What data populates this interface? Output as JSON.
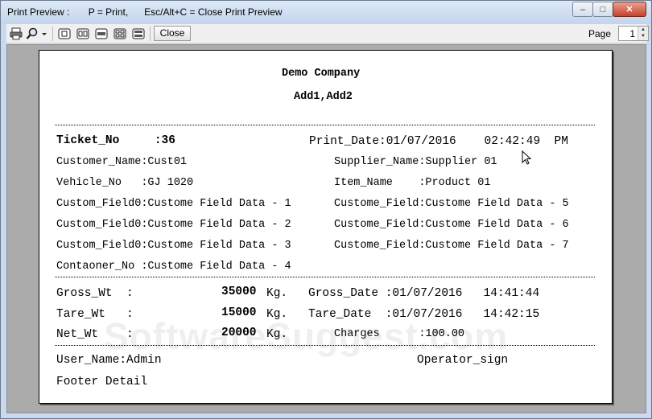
{
  "window": {
    "title": "Print Preview :       P = Print,      Esc/Alt+C = Close Print Preview",
    "controls": {
      "minimize": "–",
      "maximize": "□",
      "close": "✕"
    }
  },
  "toolbar": {
    "close_label": "Close",
    "page_label": "Page",
    "page_value": "1",
    "icons": [
      "printer-icon",
      "zoom-icon",
      "one-page-icon",
      "two-page-icon",
      "three-page-icon",
      "four-page-icon",
      "six-page-icon"
    ]
  },
  "report": {
    "company": "Demo Company",
    "address": "Add1,Add2",
    "ticket_label": "Ticket_No     :36",
    "print_date": "Print_Date:01/07/2016    02:42:49  PM",
    "customer": "Customer_Name:Cust01",
    "supplier": "Supplier_Name:Supplier 01",
    "vehicle": "Vehicle_No   :GJ 1020",
    "item": "Item_Name    :Product 01",
    "custom_left": [
      "Custom_Field0:Custome Field Data - 1",
      "Custom_Field0:Custome Field Data - 2",
      "Custom_Field0:Custome Field Data - 3",
      "Contaoner_No :Custome Field Data - 4"
    ],
    "custom_right": [
      "Custome_Field:Custome Field Data - 5",
      "Custome_Field:Custome Field Data - 6",
      "Custome_Field:Custome Field Data - 7"
    ],
    "gross_label": "Gross_Wt  :",
    "gross_value": "35000",
    "tare_label": "Tare_Wt   :",
    "tare_value": "15000",
    "net_label": "Net_Wt    :",
    "net_value": "20000",
    "unit": "Kg.",
    "gross_date": "Gross_Date :01/07/2016   14:41:44",
    "tare_date": "Tare_Date  :01/07/2016   14:42:15",
    "charges": "Charges      :100.00",
    "user": "User_Name:Admin",
    "operator": "Operator_sign",
    "footer": "Footer Detail"
  },
  "watermark": "SoftwareSuggest.com"
}
